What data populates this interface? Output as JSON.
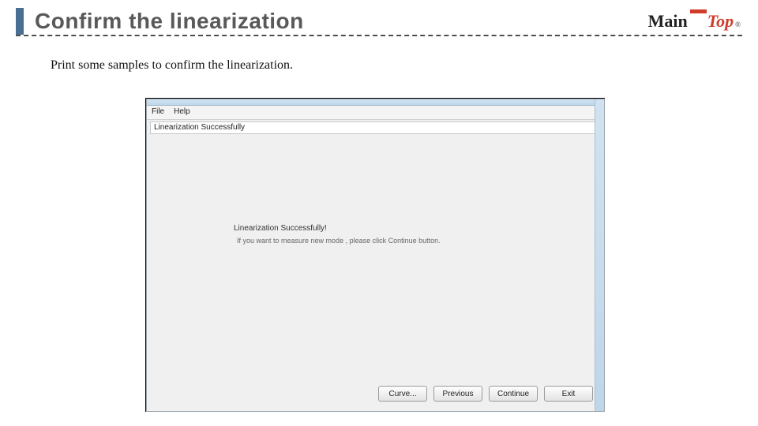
{
  "slide": {
    "title": "Confirm the linearization",
    "body_text": "Print some samples to confirm the linearization."
  },
  "logo": {
    "main": "Main",
    "top": "Top",
    "reg": "®"
  },
  "app": {
    "menu": {
      "file": "File",
      "help": "Help"
    },
    "address": "Linearization Successfully",
    "msg1": "Linearization Successfully!",
    "msg2": "If you want to measure new mode , please click Continue button.",
    "buttons": {
      "curve": "Curve...",
      "previous": "Previous",
      "continue": "Continue",
      "exit": "Exit"
    }
  }
}
